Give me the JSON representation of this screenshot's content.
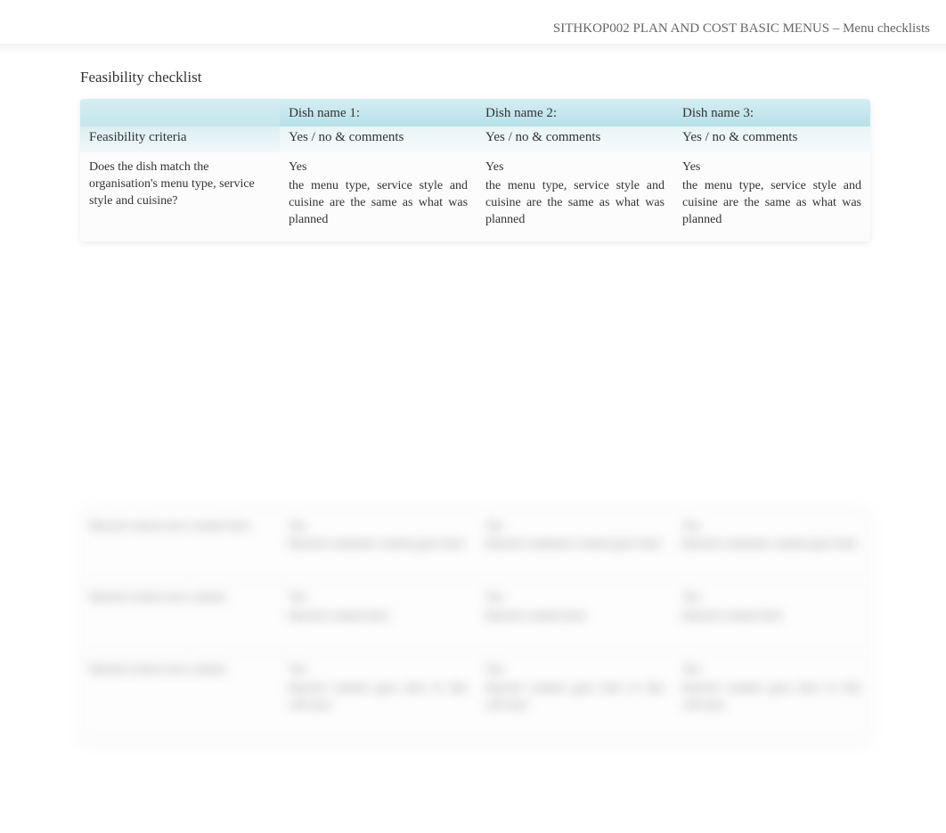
{
  "header": {
    "breadcrumb": "SITHKOP002 PLAN AND COST BASIC MENUS – Menu checklists"
  },
  "title": "Feasibility checklist",
  "table": {
    "col_criteria": "Feasibility criteria",
    "col_dish1": "Dish name 1:",
    "col_dish2": "Dish name 2:",
    "col_dish3": "Dish name 3:",
    "subhead1": "Yes / no & comments",
    "subhead2": "Yes / no & comments",
    "subhead3": "Yes / no & comments",
    "rows": [
      {
        "criteria": "Does the dish match the organisation's menu type, service style and cuisine?",
        "d1_ans": "Yes",
        "d1_comment": "the menu type, service style and cuisine are the same as what was planned",
        "d2_ans": "Yes",
        "d2_comment": "the menu type, service style and cuisine are the same as what was planned",
        "d3_ans": "Yes",
        "d3_comment": "the menu type, service style and cuisine are the same as what was planned"
      }
    ]
  },
  "blurred": {
    "rows": [
      {
        "criteria": "blurred criteria text content here",
        "d1_ans": "Yes",
        "d1_comment": "blurred comment content goes here",
        "d2_ans": "Yes",
        "d2_comment": "blurred comment content goes here",
        "d3_ans": "Yes",
        "d3_comment": "blurred comment content goes here"
      },
      {
        "criteria": "blurred criteria text content",
        "d1_ans": "Yes",
        "d1_comment": "blurred content here",
        "d2_ans": "Yes",
        "d2_comment": "blurred content here",
        "d3_ans": "Yes",
        "d3_comment": "blurred content here"
      },
      {
        "criteria": "blurred criteria text content",
        "d1_ans": "Yes",
        "d1_comment": "blurred content goes here in this cell area",
        "d2_ans": "Yes",
        "d2_comment": "blurred content goes here in this cell area",
        "d3_ans": "Yes",
        "d3_comment": "blurred content goes here in this cell area"
      }
    ]
  }
}
